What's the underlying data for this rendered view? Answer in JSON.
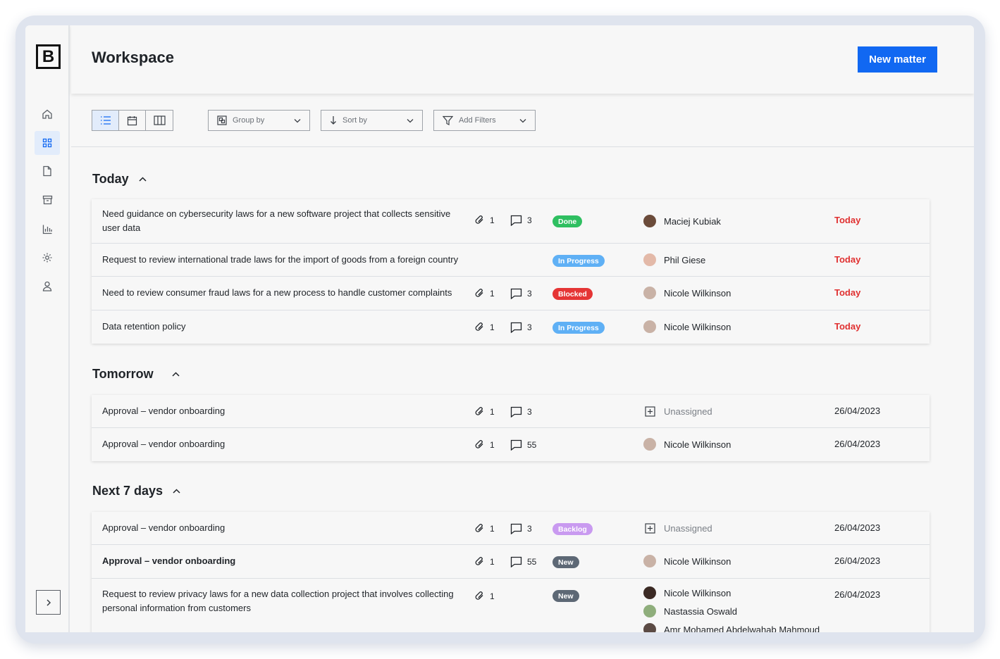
{
  "app": {
    "logo_letter": "B",
    "title": "Workspace",
    "new_button": "New matter"
  },
  "sidebar": {
    "items": [
      {
        "icon": "home-icon",
        "active": false
      },
      {
        "icon": "grid-icon",
        "active": true
      },
      {
        "icon": "document-icon",
        "active": false
      },
      {
        "icon": "archive-icon",
        "active": false
      },
      {
        "icon": "chart-icon",
        "active": false
      },
      {
        "icon": "gear-icon",
        "active": false
      },
      {
        "icon": "user-icon",
        "active": false
      }
    ],
    "expand_icon": "chevron-right-icon"
  },
  "toolbar": {
    "views": [
      "list-view",
      "calendar-view",
      "board-view"
    ],
    "active_view": "list-view",
    "group_by": "Group by",
    "sort_by": "Sort by",
    "add_filters": "Add Filters"
  },
  "status_colors": {
    "Done": "#2fbf61",
    "In Progress": "#5fb0f5",
    "Blocked": "#e53535",
    "Backlog": "#c99af0",
    "New": "#5d6875"
  },
  "sections": [
    {
      "title": "Today",
      "rows": [
        {
          "title": "Need guidance on cybersecurity laws for a new software project that collects sensitive user data",
          "bold": false,
          "attachments": "1",
          "comments": "3",
          "status": "Done",
          "assignees": [
            "Maciej Kubiak"
          ],
          "due": "Today",
          "due_today": true
        },
        {
          "title": "Request to review international trade laws for the import of goods from a foreign country",
          "bold": false,
          "attachments": "",
          "comments": "",
          "status": "In Progress",
          "assignees": [
            "Phil Giese"
          ],
          "due": "Today",
          "due_today": true
        },
        {
          "title": "Need to review consumer fraud laws for a new process to handle customer complaints",
          "bold": false,
          "attachments": "1",
          "comments": "3",
          "status": "Blocked",
          "assignees": [
            "Nicole Wilkinson"
          ],
          "due": "Today",
          "due_today": true
        },
        {
          "title": "Data retention policy",
          "bold": false,
          "attachments": "1",
          "comments": "3",
          "status": "In Progress",
          "assignees": [
            "Nicole Wilkinson"
          ],
          "due": "Today",
          "due_today": true
        }
      ]
    },
    {
      "title": "Tomorrow",
      "rows": [
        {
          "title": "Approval – vendor onboarding",
          "bold": false,
          "attachments": "1",
          "comments": "3",
          "status": "",
          "assignees": [
            "Unassigned"
          ],
          "due": "26/04/2023",
          "due_today": false
        },
        {
          "title": "Approval – vendor onboarding",
          "bold": false,
          "attachments": "1",
          "comments": "55",
          "status": "",
          "assignees": [
            "Nicole Wilkinson"
          ],
          "due": "26/04/2023",
          "due_today": false
        }
      ]
    },
    {
      "title": "Next 7 days",
      "rows": [
        {
          "title": "Approval – vendor onboarding",
          "bold": false,
          "attachments": "1",
          "comments": "3",
          "status": "Backlog",
          "assignees": [
            "Unassigned"
          ],
          "due": "26/04/2023",
          "due_today": false
        },
        {
          "title": "Approval – vendor onboarding",
          "bold": true,
          "attachments": "1",
          "comments": "55",
          "status": "New",
          "assignees": [
            "Nicole Wilkinson"
          ],
          "due": "26/04/2023",
          "due_today": false
        },
        {
          "title": "Request to review privacy laws for a new data collection project that involves collecting personal information from customers",
          "bold": false,
          "attachments": "1",
          "comments": "",
          "status": "New",
          "assignees": [
            "Nicole Wilkinson",
            "Nastassia Oswald",
            "Amr Mohamed Abdelwahab Mahmoud"
          ],
          "due": "26/04/2023",
          "due_today": false
        }
      ]
    }
  ]
}
